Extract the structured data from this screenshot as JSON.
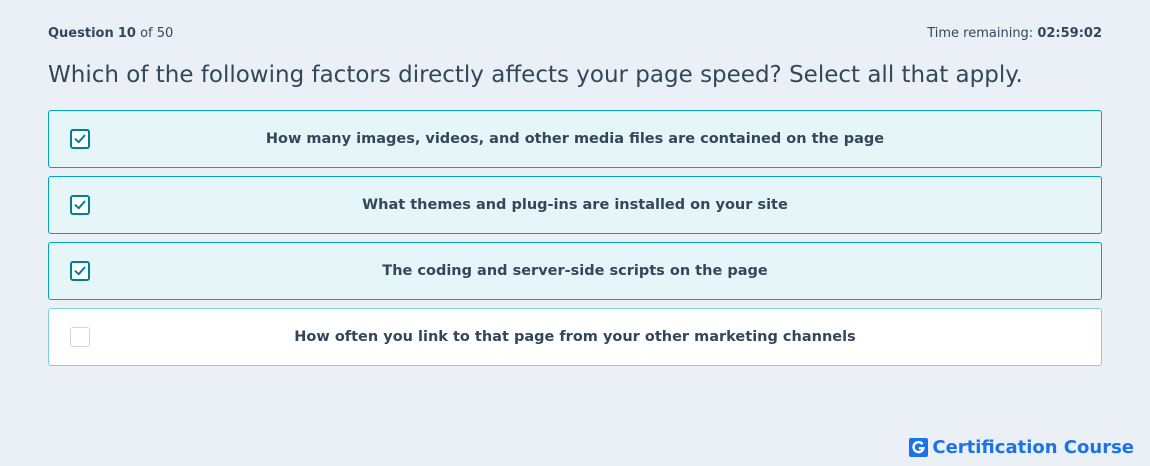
{
  "header": {
    "question_word": "Question",
    "question_number": "10",
    "question_of": "of 50",
    "time_label": "Time remaining:",
    "time_value": "02:59:02"
  },
  "question": {
    "text": "Which of the following factors directly affects your page speed? Select all that apply."
  },
  "options": [
    {
      "label": "How many images, videos, and other media files are contained on the page",
      "checked": true
    },
    {
      "label": "What themes and plug-ins are installed on your site",
      "checked": true
    },
    {
      "label": "The coding and server-side scripts on the page",
      "checked": true
    },
    {
      "label": "How often you link to that page from your other marketing channels",
      "checked": false
    }
  ],
  "brand": {
    "logo_letter": "G",
    "name": "Certification Course"
  },
  "colors": {
    "accent": "#00a4bd",
    "checkmark": "#00808f",
    "text": "#33475b",
    "background": "#eaf0f6",
    "brand": "#1a73e8"
  }
}
